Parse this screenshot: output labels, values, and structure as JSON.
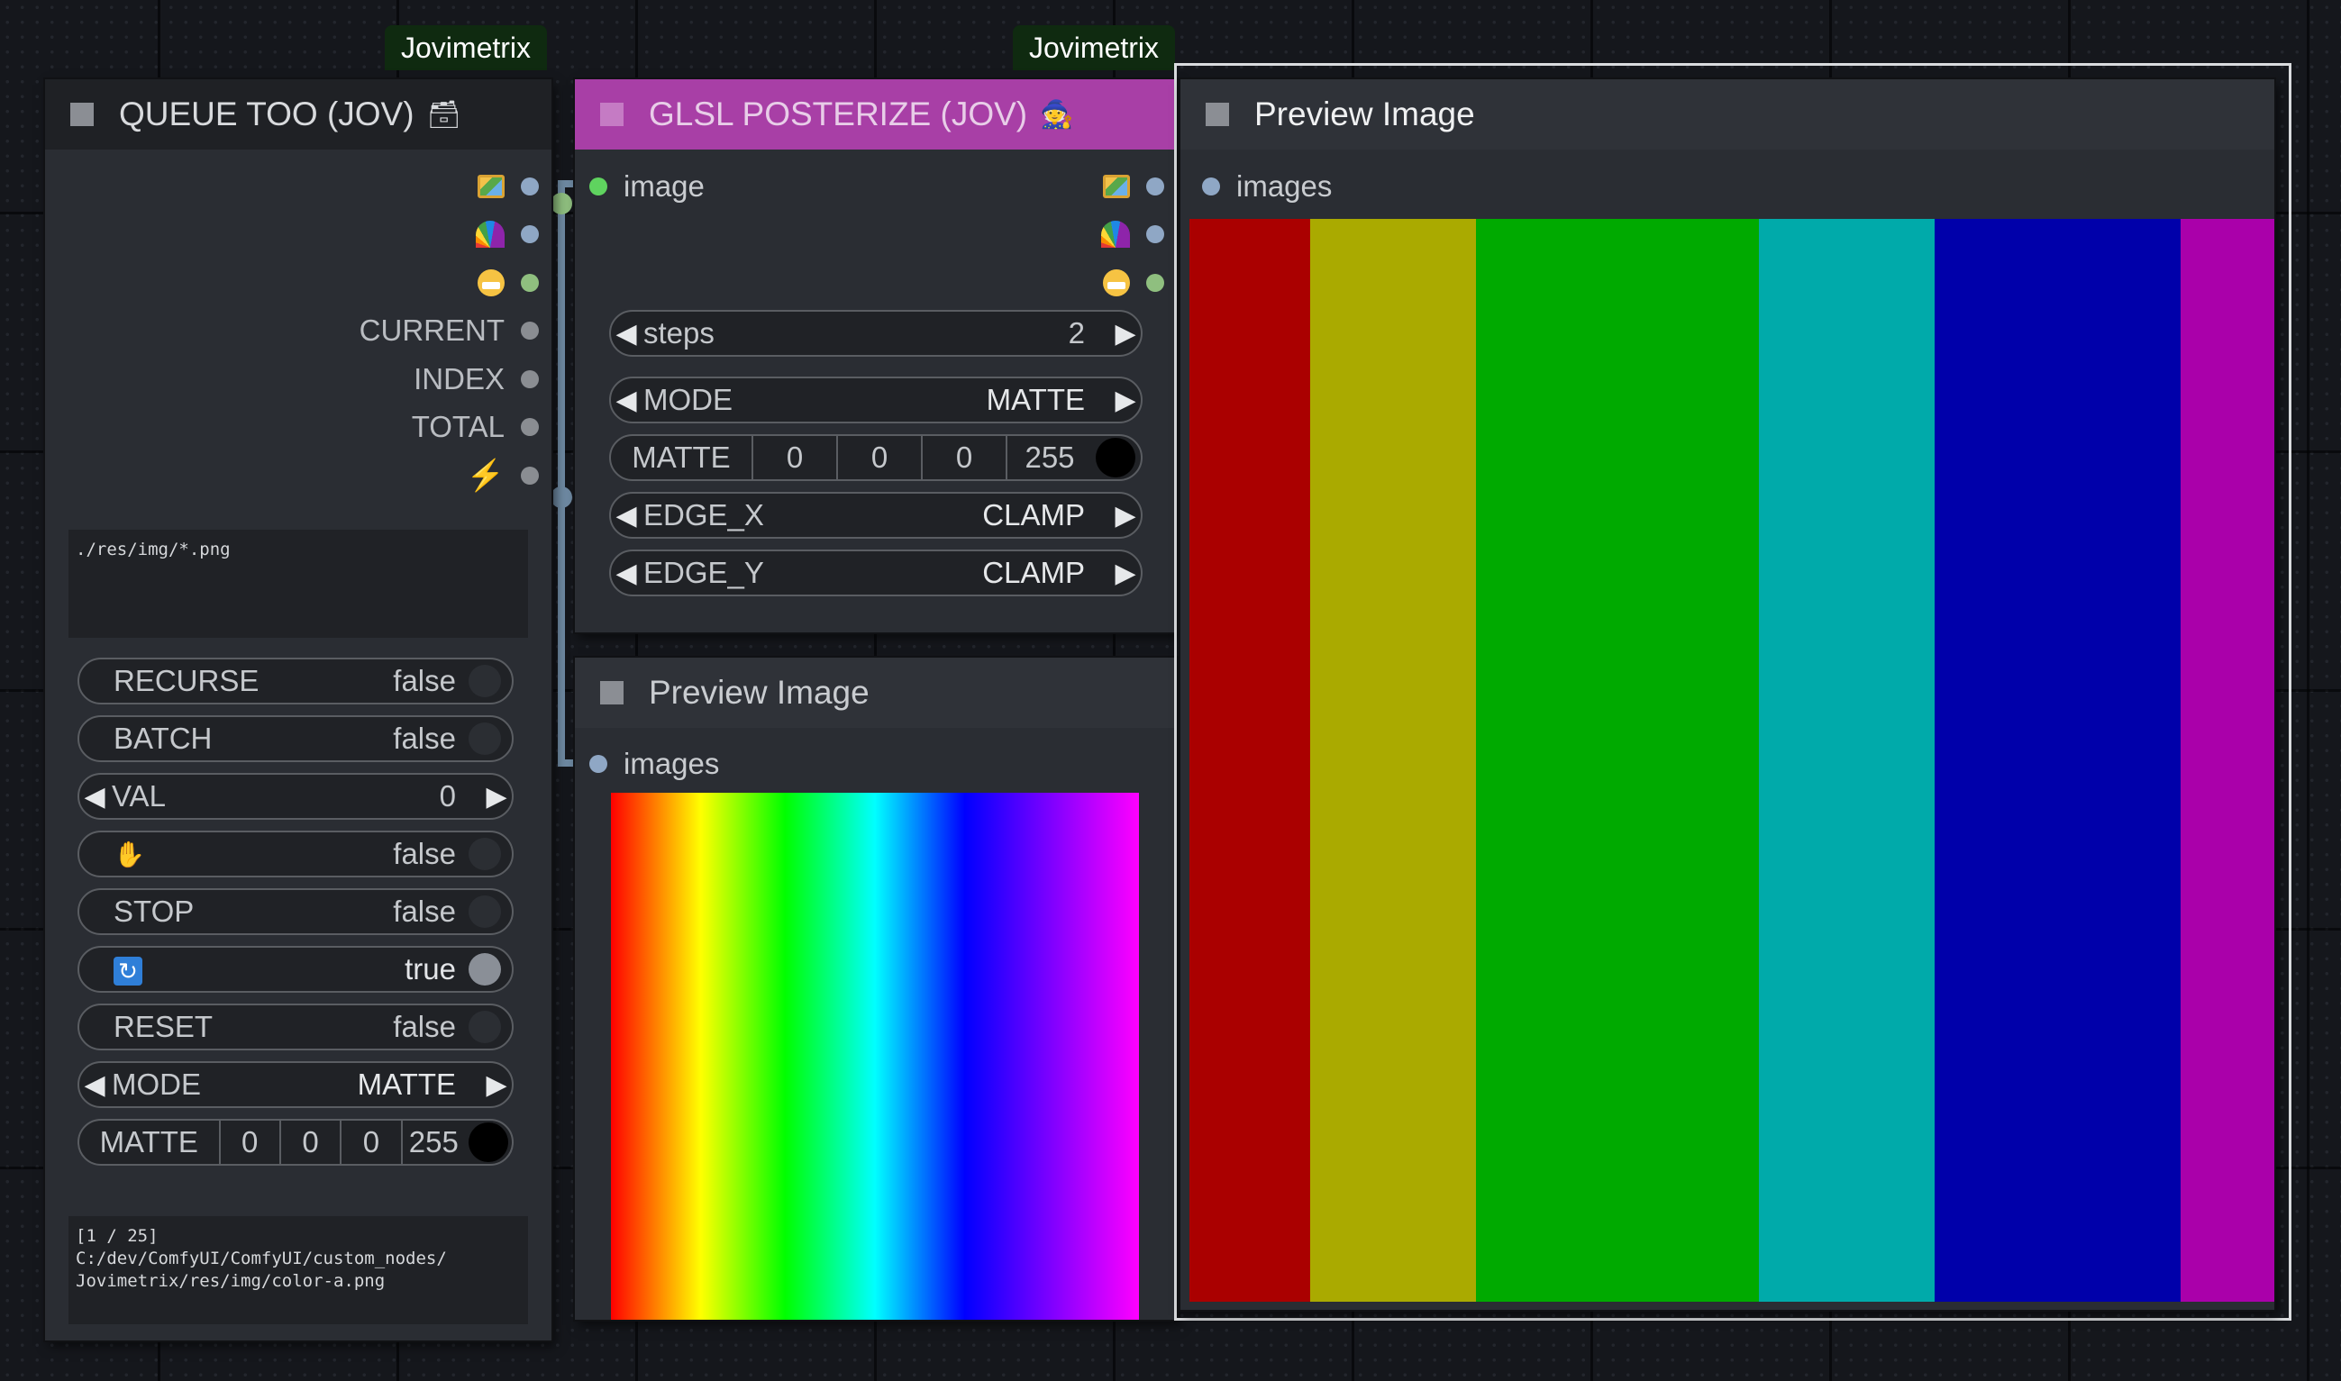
{
  "badges": [
    "Jovimetrix",
    "Jovimetrix"
  ],
  "queue_node": {
    "title": "QUEUE TOO (JOV)",
    "title_emoji": "🗃",
    "outputs": [
      {
        "icon": "image-icon"
      },
      {
        "icon": "rainbow-icon"
      },
      {
        "icon": "face-mask-icon"
      },
      {
        "label": "CURRENT"
      },
      {
        "label": "INDEX"
      },
      {
        "label": "TOTAL"
      },
      {
        "icon": "lightning-icon"
      }
    ],
    "path_value": "./res/img/*.png",
    "widgets": {
      "recurse": {
        "label": "RECURSE",
        "value": "false"
      },
      "batch": {
        "label": "BATCH",
        "value": "false"
      },
      "val": {
        "label": "VAL",
        "value": "0"
      },
      "hold": {
        "icon": "hand-icon",
        "value": "false"
      },
      "stop": {
        "label": "STOP",
        "value": "false"
      },
      "loop": {
        "icon": "loop-icon",
        "value": "true"
      },
      "reset": {
        "label": "RESET",
        "value": "false"
      },
      "mode": {
        "label": "MODE",
        "value": "MATTE"
      },
      "matte": {
        "label": "MATTE",
        "r": "0",
        "g": "0",
        "b": "0",
        "a": "255"
      }
    },
    "status_text": "[1 / 25]\nC:/dev/ComfyUI/ComfyUI/custom_nodes/\nJovimetrix/res/img/color-a.png"
  },
  "posterize_node": {
    "title": "GLSL POSTERIZE (JOV)",
    "title_emoji": "🧙",
    "input": "image",
    "widgets": {
      "steps": {
        "label": "steps",
        "value": "2"
      },
      "mode": {
        "label": "MODE",
        "value": "MATTE"
      },
      "matte": {
        "label": "MATTE",
        "r": "0",
        "g": "0",
        "b": "0",
        "a": "255"
      },
      "edge_x": {
        "label": "EDGE_X",
        "value": "CLAMP"
      },
      "edge_y": {
        "label": "EDGE_Y",
        "value": "CLAMP"
      }
    }
  },
  "preview_small": {
    "title": "Preview Image",
    "input": "images"
  },
  "preview_large": {
    "title": "Preview Image",
    "input": "images",
    "bands": [
      "#aa0000",
      "#aaaa00",
      "#00aa00",
      "#00aaaa",
      "#0000aa",
      "#aa00aa"
    ]
  },
  "colors": {
    "posterize_header": "#a83fa6",
    "image_slot": "#8fa7c5",
    "mask_slot": "#8fbf7f",
    "active_input": "#5fd35f"
  }
}
